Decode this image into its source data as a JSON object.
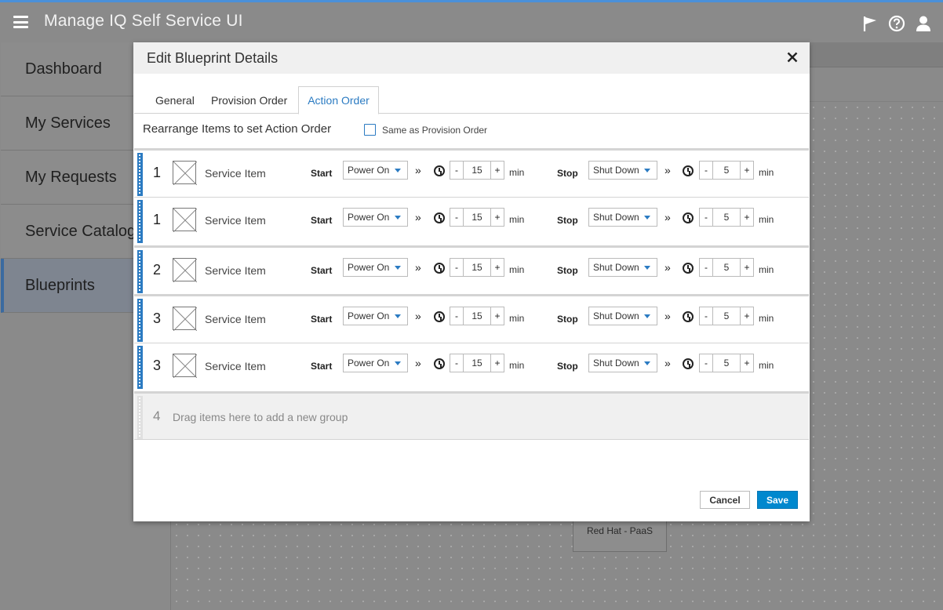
{
  "app": {
    "title": "Manage IQ Self Service UI"
  },
  "topbar": {
    "icons": [
      "flag-icon",
      "help-icon",
      "user-icon"
    ]
  },
  "sidebar": {
    "items": [
      {
        "label": "Dashboard"
      },
      {
        "label": "My Services"
      },
      {
        "label": "My Requests"
      },
      {
        "label": "Service Catalog"
      },
      {
        "label": "Blueprints",
        "active": true
      }
    ]
  },
  "canvas": {
    "node_label": "Red Hat - PaaS"
  },
  "modal": {
    "title": "Edit Blueprint Details",
    "tabs": [
      {
        "label": "General"
      },
      {
        "label": "Provision Order"
      },
      {
        "label": "Action Order",
        "active": true
      }
    ],
    "rearrange_label": "Rearrange Items to set Action Order",
    "same_as_label": "Same as Provision Order",
    "same_as_checked": false,
    "labels": {
      "start": "Start",
      "stop": "Stop",
      "min": "min",
      "minus": "-",
      "plus": "+"
    },
    "rows": [
      {
        "group": "1",
        "name": "Service Item",
        "start_action": "Power On",
        "start_delay": "15",
        "stop_action": "Shut Down",
        "stop_delay": "5"
      },
      {
        "group": "1",
        "name": "Service Item",
        "start_action": "Power On",
        "start_delay": "15",
        "stop_action": "Shut Down",
        "stop_delay": "5"
      },
      {
        "group": "2",
        "name": "Service Item",
        "start_action": "Power On",
        "start_delay": "15",
        "stop_action": "Shut Down",
        "stop_delay": "5"
      },
      {
        "group": "3",
        "name": "Service Item",
        "start_action": "Power On",
        "start_delay": "15",
        "stop_action": "Shut Down",
        "stop_delay": "5"
      },
      {
        "group": "3",
        "name": "Service Item",
        "start_action": "Power On",
        "start_delay": "15",
        "stop_action": "Shut Down",
        "stop_delay": "5"
      }
    ],
    "drop_zone": {
      "group": "4",
      "text": "Drag items here to add a new group"
    },
    "buttons": {
      "cancel": "Cancel",
      "save": "Save"
    }
  },
  "colors": {
    "accent": "#2b7bc2",
    "primary_button": "#0088ce",
    "top_border": "#4a90d9"
  }
}
